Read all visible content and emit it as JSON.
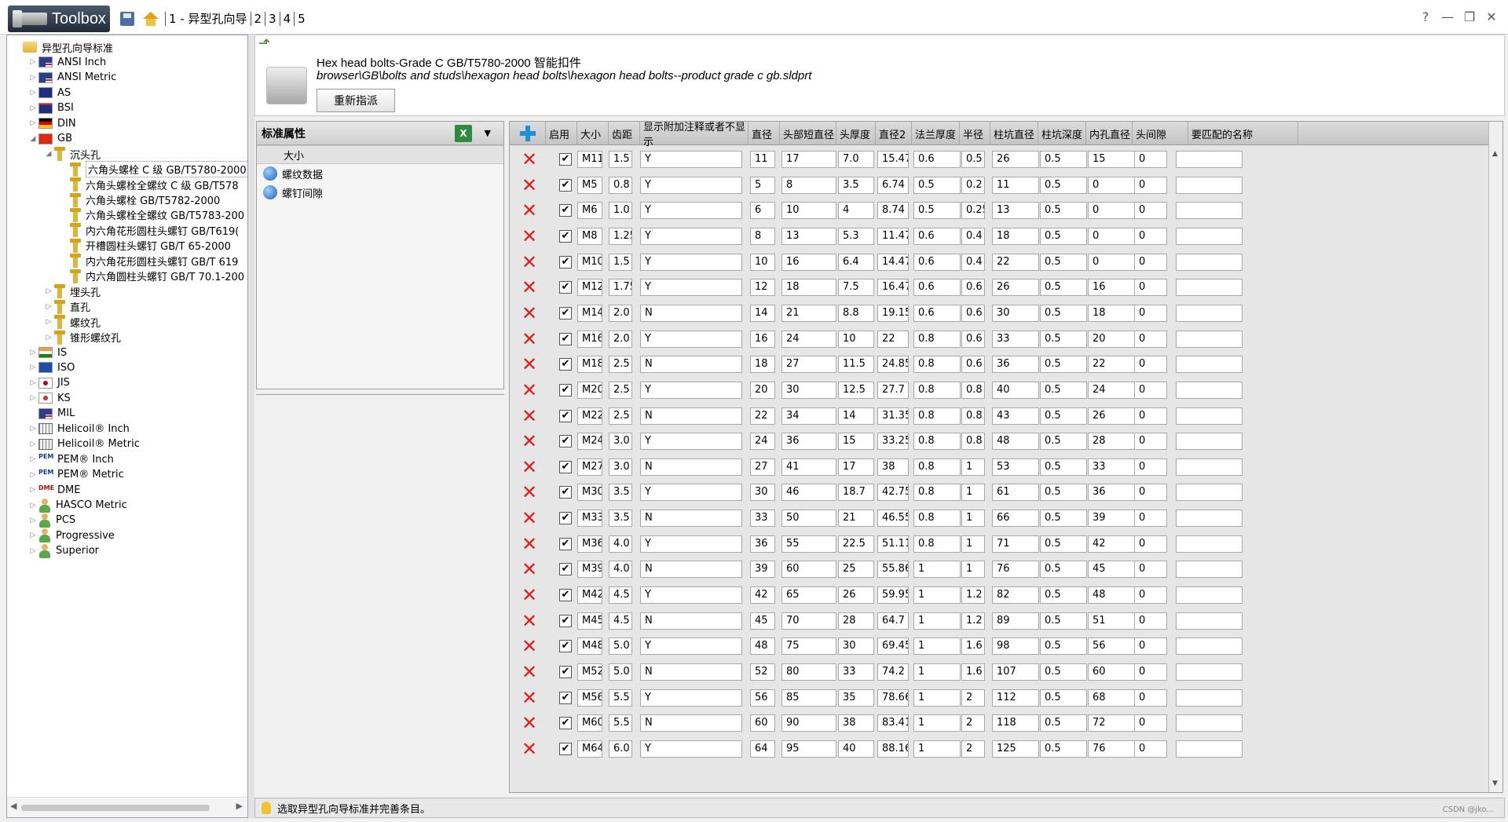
{
  "titlebar": {
    "app_name": "Toolbox",
    "tabs": [
      "1 - 异型孔向导",
      "2",
      "3",
      "4",
      "5"
    ],
    "icons": [
      "save-icon",
      "home-icon",
      "help-icon",
      "minimize-icon",
      "restore-icon",
      "close-icon"
    ],
    "right_glyphs": [
      "?",
      "—",
      "❐",
      "✕"
    ]
  },
  "tree": {
    "root": "异型孔向导标准",
    "nodes": [
      {
        "label": "ANSI Inch",
        "icon": "us-flag-icon"
      },
      {
        "label": "ANSI Metric",
        "icon": "us-flag-icon"
      },
      {
        "label": "AS",
        "icon": "au-flag-icon"
      },
      {
        "label": "BSI",
        "icon": "uk-flag-icon"
      },
      {
        "label": "DIN",
        "icon": "de-flag-icon"
      },
      {
        "label": "GB",
        "icon": "cn-flag-icon"
      },
      {
        "label": "沉头孔",
        "icon": "bolt-icon"
      },
      {
        "label": "六角头螺栓 C 级 GB/T5780-2000",
        "icon": "bolt-icon"
      },
      {
        "label": "六角头螺栓全螺纹 C 级 GB/T578",
        "icon": "bolt-icon"
      },
      {
        "label": "六角头螺栓 GB/T5782-2000",
        "icon": "bolt-icon"
      },
      {
        "label": "六角头螺栓全螺纹 GB/T5783-200",
        "icon": "bolt-icon"
      },
      {
        "label": "内六角花形圆柱头螺钉 GB/T619(",
        "icon": "bolt-icon"
      },
      {
        "label": "开槽圆柱头螺钉 GB/T 65-2000",
        "icon": "bolt-icon"
      },
      {
        "label": "内六角花形圆柱头螺钉 GB/T 619",
        "icon": "bolt-icon"
      },
      {
        "label": "内六角圆柱头螺钉 GB/T 70.1-200",
        "icon": "bolt-icon"
      },
      {
        "label": "埋头孔",
        "icon": "bolt-icon"
      },
      {
        "label": "直孔",
        "icon": "bolt-icon"
      },
      {
        "label": "螺纹孔",
        "icon": "bolt-icon"
      },
      {
        "label": "锥形螺纹孔",
        "icon": "bolt-icon"
      },
      {
        "label": "IS",
        "icon": "in-flag-icon"
      },
      {
        "label": "ISO",
        "icon": "iso-icon"
      },
      {
        "label": "JIS",
        "icon": "jp-flag-icon"
      },
      {
        "label": "KS",
        "icon": "kr-flag-icon"
      },
      {
        "label": "MIL",
        "icon": "us-flag-icon"
      },
      {
        "label": "Helicoil® Inch",
        "icon": "helicoil-icon"
      },
      {
        "label": "Helicoil® Metric",
        "icon": "helicoil-icon"
      },
      {
        "label": "PEM® Inch",
        "icon": "pem-icon"
      },
      {
        "label": "PEM® Metric",
        "icon": "pem-icon"
      },
      {
        "label": "DME",
        "icon": "dme-icon"
      },
      {
        "label": "HASCO Metric",
        "icon": "person-icon"
      },
      {
        "label": "PCS",
        "icon": "person-icon"
      },
      {
        "label": "Progressive",
        "icon": "person-icon"
      },
      {
        "label": "Superior",
        "icon": "person-icon"
      }
    ]
  },
  "header": {
    "title": "Hex head bolts-Grade C GB/T5780-2000 智能扣件",
    "path": "browser\\GB\\bolts and studs\\hexagon head bolts\\hexagon head bolts--product grade c gb.sldprt",
    "reassign_button": "重新指派"
  },
  "props": {
    "title": "标准属性",
    "excel_glyph": "X",
    "items": [
      "大小",
      "螺纹数据",
      "螺钉间隙"
    ]
  },
  "table": {
    "columns": [
      "启用",
      "大小",
      "齿距",
      "显示附加注释或者不显示",
      "直径",
      "头部短直径",
      "头厚度",
      "直径2",
      "法兰厚度",
      "半径",
      "柱坑直径",
      "柱坑深度",
      "内孔直径",
      "头间隙",
      "要匹配的名称"
    ],
    "rows": [
      [
        "M11",
        "1.5",
        "Y",
        "11",
        "17",
        "7.0",
        "15.47",
        "0.6",
        "0.5",
        "26",
        "0.5",
        "15",
        "0",
        ""
      ],
      [
        "M5",
        "0.8",
        "Y",
        "5",
        "8",
        "3.5",
        "6.74",
        "0.5",
        "0.2",
        "11",
        "0.5",
        "0",
        "0",
        ""
      ],
      [
        "M6",
        "1.0",
        "Y",
        "6",
        "10",
        "4",
        "8.74",
        "0.5",
        "0.25",
        "13",
        "0.5",
        "0",
        "0",
        ""
      ],
      [
        "M8",
        "1.25",
        "Y",
        "8",
        "13",
        "5.3",
        "11.47",
        "0.6",
        "0.4",
        "18",
        "0.5",
        "0",
        "0",
        ""
      ],
      [
        "M10",
        "1.5",
        "Y",
        "10",
        "16",
        "6.4",
        "14.47",
        "0.6",
        "0.4",
        "22",
        "0.5",
        "0",
        "0",
        ""
      ],
      [
        "M12",
        "1.75",
        "Y",
        "12",
        "18",
        "7.5",
        "16.47",
        "0.6",
        "0.6",
        "26",
        "0.5",
        "16",
        "0",
        ""
      ],
      [
        "M14",
        "2.0",
        "N",
        "14",
        "21",
        "8.8",
        "19.15",
        "0.6",
        "0.6",
        "30",
        "0.5",
        "18",
        "0",
        ""
      ],
      [
        "M16",
        "2.0",
        "Y",
        "16",
        "24",
        "10",
        "22",
        "0.8",
        "0.6",
        "33",
        "0.5",
        "20",
        "0",
        ""
      ],
      [
        "M18",
        "2.5",
        "N",
        "18",
        "27",
        "11.5",
        "24.85",
        "0.8",
        "0.6",
        "36",
        "0.5",
        "22",
        "0",
        ""
      ],
      [
        "M20",
        "2.5",
        "Y",
        "20",
        "30",
        "12.5",
        "27.7",
        "0.8",
        "0.8",
        "40",
        "0.5",
        "24",
        "0",
        ""
      ],
      [
        "M22",
        "2.5",
        "N",
        "22",
        "34",
        "14",
        "31.35",
        "0.8",
        "0.8",
        "43",
        "0.5",
        "26",
        "0",
        ""
      ],
      [
        "M24",
        "3.0",
        "Y",
        "24",
        "36",
        "15",
        "33.25",
        "0.8",
        "0.8",
        "48",
        "0.5",
        "28",
        "0",
        ""
      ],
      [
        "M27",
        "3.0",
        "N",
        "27",
        "41",
        "17",
        "38",
        "0.8",
        "1",
        "53",
        "0.5",
        "33",
        "0",
        ""
      ],
      [
        "M30",
        "3.5",
        "Y",
        "30",
        "46",
        "18.7",
        "42.75",
        "0.8",
        "1",
        "61",
        "0.5",
        "36",
        "0",
        ""
      ],
      [
        "M33",
        "3.5",
        "N",
        "33",
        "50",
        "21",
        "46.55",
        "0.8",
        "1",
        "66",
        "0.5",
        "39",
        "0",
        ""
      ],
      [
        "M36",
        "4.0",
        "Y",
        "36",
        "55",
        "22.5",
        "51.11",
        "0.8",
        "1",
        "71",
        "0.5",
        "42",
        "0",
        ""
      ],
      [
        "M39",
        "4.0",
        "N",
        "39",
        "60",
        "25",
        "55.86",
        "1",
        "1",
        "76",
        "0.5",
        "45",
        "0",
        ""
      ],
      [
        "M42",
        "4.5",
        "Y",
        "42",
        "65",
        "26",
        "59.95",
        "1",
        "1.2",
        "82",
        "0.5",
        "48",
        "0",
        ""
      ],
      [
        "M45",
        "4.5",
        "N",
        "45",
        "70",
        "28",
        "64.7",
        "1",
        "1.2",
        "89",
        "0.5",
        "51",
        "0",
        ""
      ],
      [
        "M48",
        "5.0",
        "Y",
        "48",
        "75",
        "30",
        "69.45",
        "1",
        "1.6",
        "98",
        "0.5",
        "56",
        "0",
        ""
      ],
      [
        "M52",
        "5.0",
        "N",
        "52",
        "80",
        "33",
        "74.2",
        "1",
        "1.6",
        "107",
        "0.5",
        "60",
        "0",
        ""
      ],
      [
        "M56",
        "5.5",
        "Y",
        "56",
        "85",
        "35",
        "78.66",
        "1",
        "2",
        "112",
        "0.5",
        "68",
        "0",
        ""
      ],
      [
        "M60",
        "5.5",
        "N",
        "60",
        "90",
        "38",
        "83.41",
        "1",
        "2",
        "118",
        "0.5",
        "72",
        "0",
        ""
      ],
      [
        "M64",
        "6.0",
        "Y",
        "64",
        "95",
        "40",
        "88.16",
        "1",
        "2",
        "125",
        "0.5",
        "76",
        "0",
        ""
      ]
    ],
    "enabled_mark": "✔",
    "delete_mark": "✕"
  },
  "status": {
    "message": "选取异型孔向导标准并完善条目。"
  },
  "watermark": "CSDN @jko..."
}
